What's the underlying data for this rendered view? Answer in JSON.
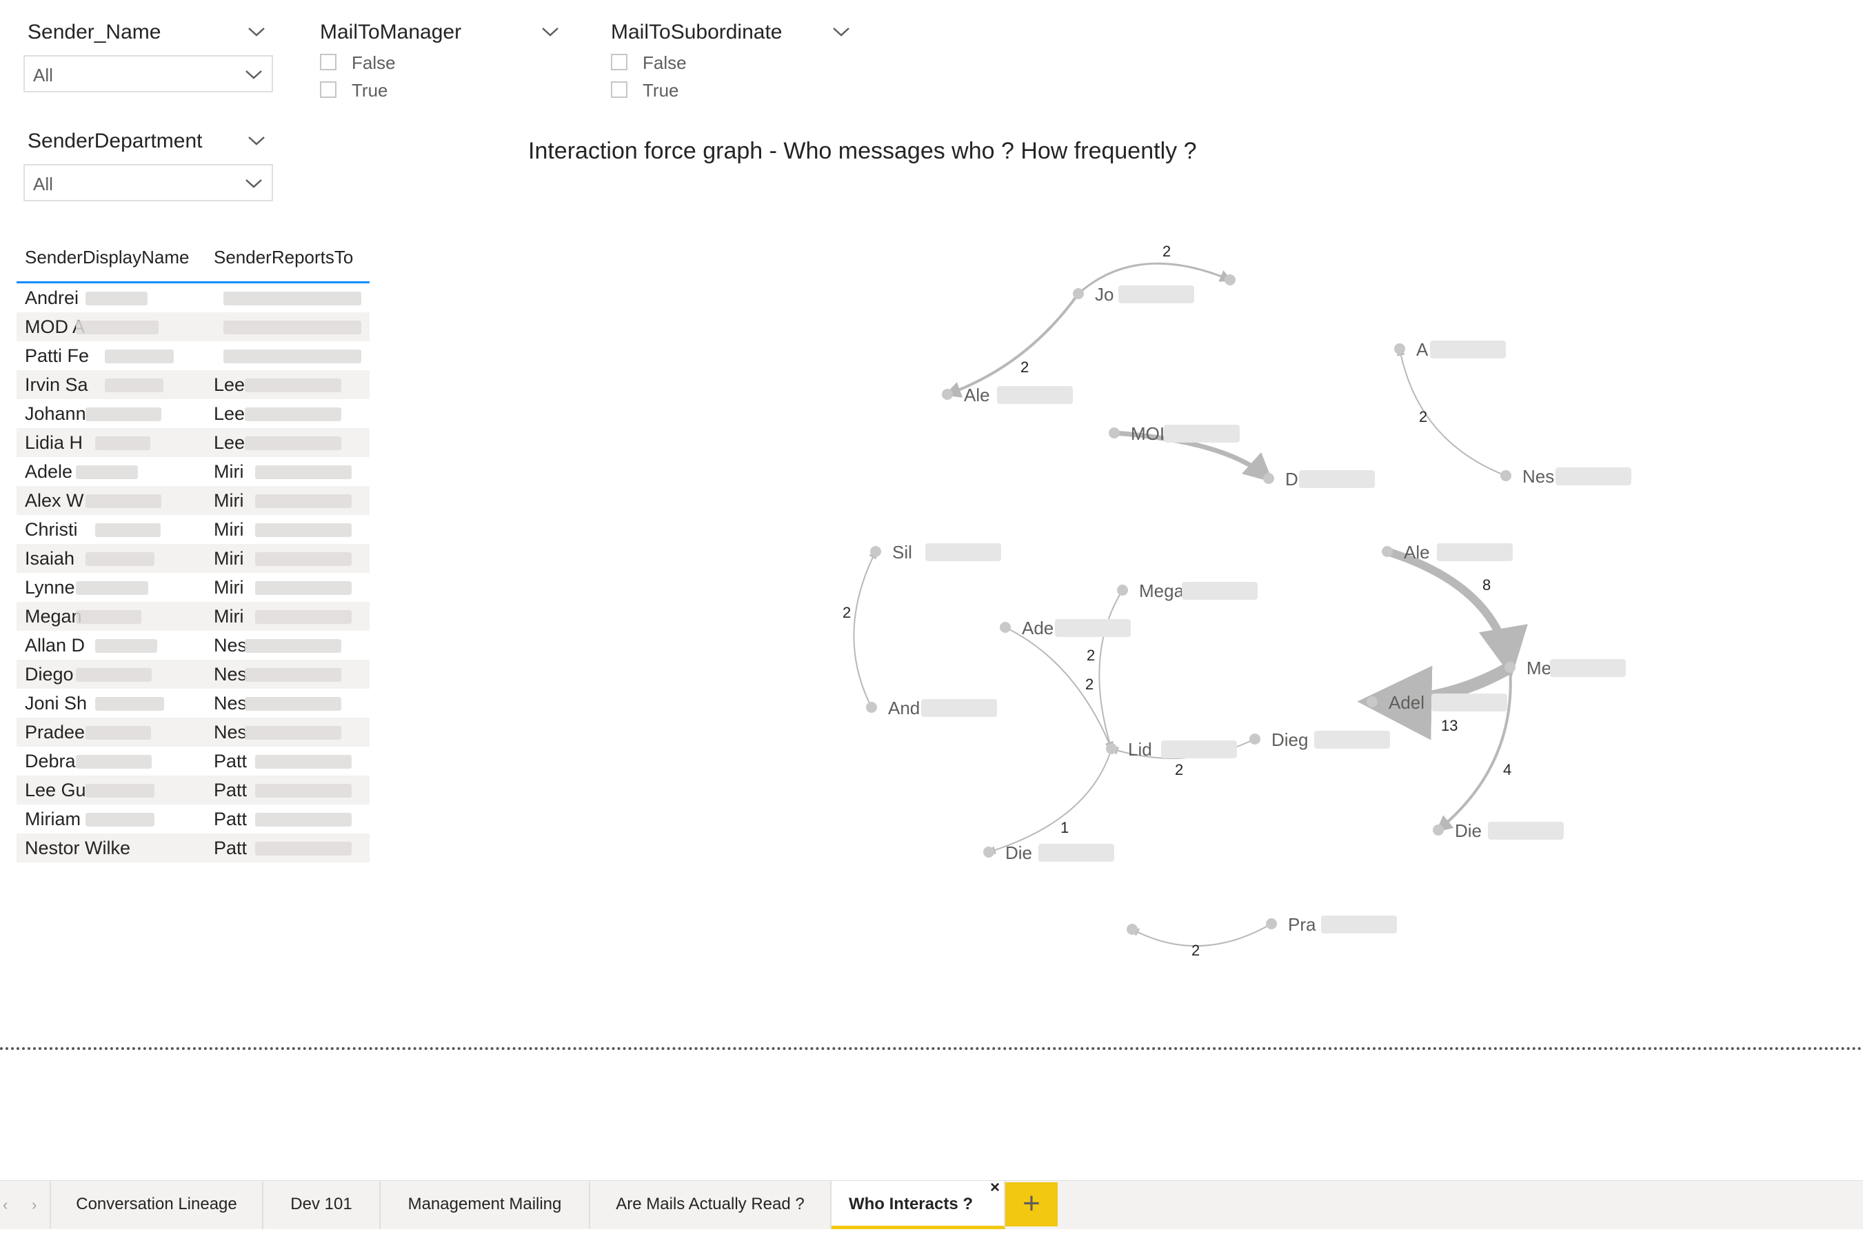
{
  "filters": {
    "sender_name": {
      "title": "Sender_Name",
      "value": "All"
    },
    "sender_department": {
      "title": "SenderDepartment",
      "value": "All"
    },
    "mail_to_manager": {
      "title": "MailToManager",
      "options": [
        "False",
        "True"
      ]
    },
    "mail_to_subordinate": {
      "title": "MailToSubordinate",
      "options": [
        "False",
        "True"
      ]
    }
  },
  "table": {
    "headers": [
      "SenderDisplayName",
      "SenderReportsTo"
    ],
    "rows": [
      {
        "name": "Andrei",
        "reports": ""
      },
      {
        "name": "MOD A",
        "reports": ""
      },
      {
        "name": "Patti Fe",
        "reports": ""
      },
      {
        "name": "Irvin Sa",
        "reports": "Lee"
      },
      {
        "name": "Johann",
        "reports": "Lee"
      },
      {
        "name": "Lidia H",
        "reports": "Lee"
      },
      {
        "name": "Adele",
        "reports": "Miri"
      },
      {
        "name": "Alex W",
        "reports": "Miri"
      },
      {
        "name": "Christi",
        "reports": "Miri"
      },
      {
        "name": "Isaiah",
        "reports": "Miri"
      },
      {
        "name": "Lynne",
        "reports": "Miri"
      },
      {
        "name": "Megan",
        "reports": "Miri"
      },
      {
        "name": "Allan D",
        "reports": "Nes"
      },
      {
        "name": "Diego",
        "reports": "Nes"
      },
      {
        "name": "Joni Sh",
        "reports": "Nes"
      },
      {
        "name": "Pradee",
        "reports": "Nes"
      },
      {
        "name": "Debra",
        "reports": "Patt"
      },
      {
        "name": "Lee Gu",
        "reports": "Patt"
      },
      {
        "name": "Miriam",
        "reports": "Patt"
      },
      {
        "name": "Nestor Wilke",
        "reports": "Patt"
      }
    ]
  },
  "graph": {
    "title": "Interaction force graph - Who messages who ? How frequently ?",
    "node_labels": {
      "jo": "Jo",
      "ale1": "Ale",
      "a": "A",
      "mo": "MOI",
      "d": "D",
      "nes": "Nes",
      "sil": "Sil",
      "and": "And",
      "mega1": "Mega",
      "ade1": "Ade",
      "lid": "Lid",
      "dieg": "Dieg",
      "die1": "Die",
      "ale2": "Ale",
      "meg2": "Me",
      "adel": "Adel",
      "die2": "Die",
      "pra": "Pra"
    },
    "edge_labels": {
      "jo_top": "2",
      "jo_ale": "2",
      "nes_a": "2",
      "and_sil": "2",
      "ade_lid_a": "2",
      "ade_lid_b": "2",
      "dieg_lid": "2",
      "lid_die": "1",
      "ale_meg": "8",
      "meg_adel": "13",
      "meg_die": "4",
      "pra_bottom": "2"
    }
  },
  "tabs": [
    {
      "label": "Conversation Lineage",
      "active": false
    },
    {
      "label": "Dev 101",
      "active": false
    },
    {
      "label": "Management Mailing",
      "active": false
    },
    {
      "label": "Are Mails Actually Read ?",
      "active": false
    },
    {
      "label": "Who Interacts ?",
      "active": true
    }
  ],
  "tab_close": "×",
  "add_tab": "+",
  "nav": {
    "prev": "‹",
    "next": "›"
  },
  "colors": {
    "accent": "#118dff",
    "active_tab": "#f2c811",
    "edge": "#b8b8b8",
    "node": "#c8c8c8"
  }
}
